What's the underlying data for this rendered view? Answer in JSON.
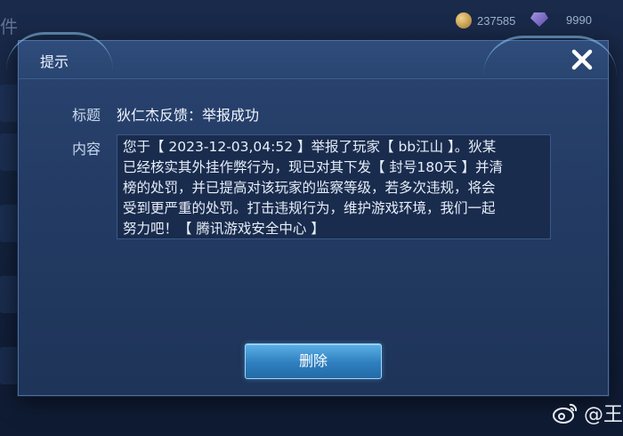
{
  "background": {
    "title_fragment": "件",
    "gold_amount": "237585",
    "gem_amount": "9990"
  },
  "dialog": {
    "title": "提示",
    "title_label": "标题",
    "title_value": "狄仁杰反馈：举报成功",
    "content_label": "内容",
    "content_lines": [
      "您于【 2023-12-03,04:52 】举报了玩家【 bb江山 】。狄某",
      "已经核实其外挂作弊行为，现已对其下发【 封号180天 】并清",
      "榜的处罚，并已提高对该玩家的监察等级，若多次违规，将会",
      "受到更严重的处罚。打击违规行为，维护游戏环境，我们一起",
      "努力吧！【 腾讯游戏安全中心 】"
    ],
    "delete_label": "删除"
  },
  "watermark": {
    "text": "@王"
  },
  "icons": {
    "close": "close-icon",
    "coin": "gold-coin-icon",
    "gem": "diamond-icon",
    "weibo": "weibo-icon"
  },
  "colors": {
    "dialog_bg": "#243c65",
    "button": "#2f7fbf",
    "text": "#e6eef9"
  }
}
